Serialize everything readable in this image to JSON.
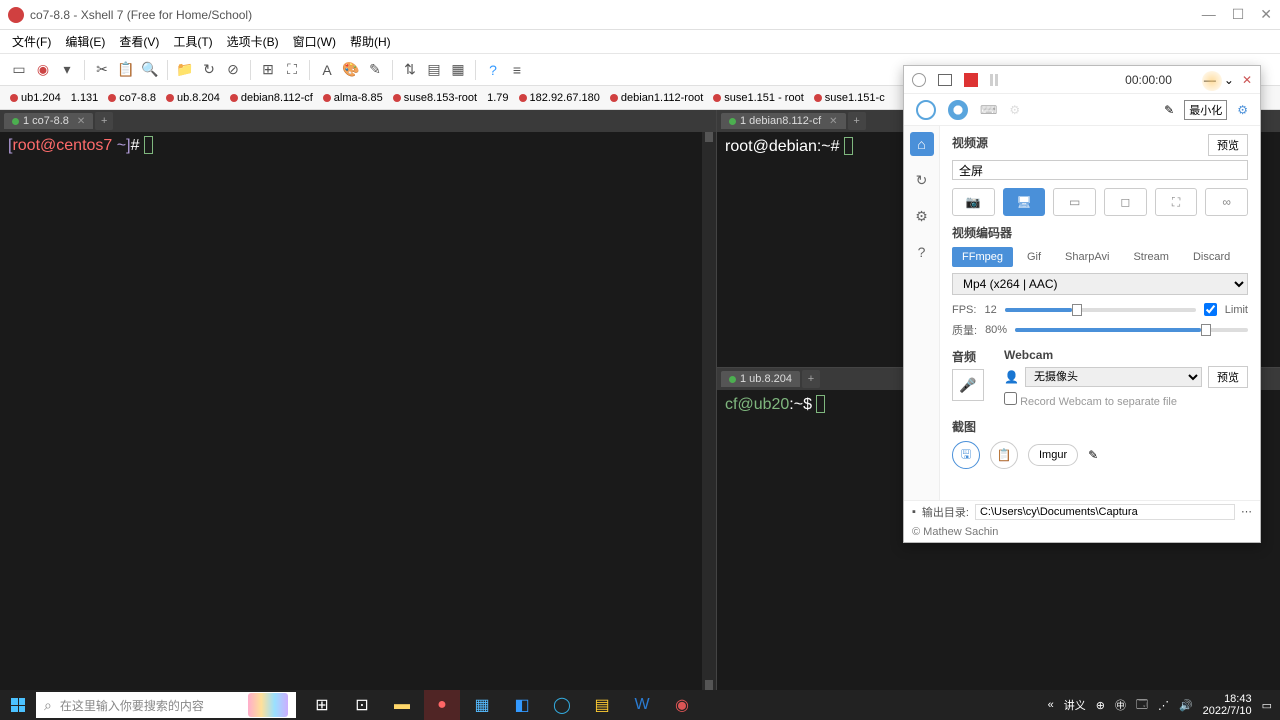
{
  "titlebar": {
    "title": "co7-8.8 - Xshell 7 (Free for Home/School)"
  },
  "menu": {
    "file": "文件(F)",
    "edit": "编辑(E)",
    "view": "查看(V)",
    "tools": "工具(T)",
    "tabs": "选项卡(B)",
    "window": "窗口(W)",
    "help": "帮助(H)"
  },
  "sessions": [
    {
      "dot": "dot-red",
      "label": "ub1.204"
    },
    {
      "dot": "",
      "label": "1.131"
    },
    {
      "dot": "dot-red",
      "label": "co7-8.8"
    },
    {
      "dot": "dot-red",
      "label": "ub.8.204"
    },
    {
      "dot": "dot-red",
      "label": "debian8.112-cf"
    },
    {
      "dot": "dot-red",
      "label": "alma-8.85"
    },
    {
      "dot": "dot-red",
      "label": "suse8.153-root"
    },
    {
      "dot": "",
      "label": "1.79"
    },
    {
      "dot": "dot-red",
      "label": "182.92.67.180"
    },
    {
      "dot": "dot-red",
      "label": "debian1.112-root"
    },
    {
      "dot": "dot-red",
      "label": "suse1.151 - root"
    },
    {
      "dot": "dot-red",
      "label": "suse1.151-c"
    }
  ],
  "panes": {
    "left": {
      "tab": "1 co7-8.8",
      "prompt_user": "root",
      "prompt_host": "centos7",
      "prompt_path": "~",
      "prompt_char": "#"
    },
    "tr": {
      "tab": "1 debian8.112-cf",
      "prompt": "root@debian:~#"
    },
    "br": {
      "tab": "1 ub.8.204",
      "prompt_user": "cf@ub20",
      "prompt_path": ":~$"
    }
  },
  "captura": {
    "timer": "00:00:00",
    "tooltip": "最小化",
    "video_source_title": "视频源",
    "preview_btn": "预览",
    "source_value": "全屏",
    "encoder_title": "视频编码器",
    "encoders": {
      "ffmpeg": "FFmpeg",
      "gif": "Gif",
      "sharpavi": "SharpAvi",
      "stream": "Stream",
      "discard": "Discard"
    },
    "codec": "Mp4 (x264 | AAC)",
    "fps_label": "FPS:",
    "fps_value": "12",
    "limit_label": "Limit",
    "quality_label": "质量:",
    "quality_value": "80%",
    "audio_title": "音频",
    "webcam_title": "Webcam",
    "webcam_value": "无摄像头",
    "webcam_check": "Record Webcam to separate file",
    "screenshot_title": "截图",
    "imgur": "Imgur",
    "output_label": "输出目录:",
    "output_path": "C:\\Users\\cy\\Documents\\Captura",
    "copyright": "© Mathew Sachin"
  },
  "taskbar": {
    "search_placeholder": "在这里输入你要搜索的内容",
    "lecture": "讲义",
    "time": "18:43",
    "date": "2022/7/10"
  }
}
